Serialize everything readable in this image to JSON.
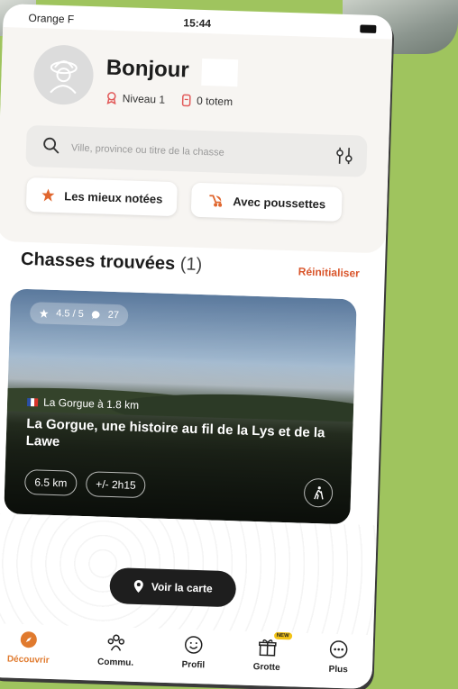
{
  "status_bar": {
    "carrier": "Orange F",
    "time": "15:44"
  },
  "header": {
    "greeting": "Bonjour",
    "level": "Niveau 1",
    "totems": "0 totem"
  },
  "search": {
    "placeholder": "Ville, province ou titre de la chasse"
  },
  "filters": [
    {
      "label": "Les mieux notées",
      "icon": "star-icon"
    },
    {
      "label": "Avec poussettes",
      "icon": "stroller-icon"
    }
  ],
  "results": {
    "title": "Chasses trouvées",
    "count": "(1)",
    "reset_label": "Réinitialiser"
  },
  "card": {
    "rating": "4.5 / 5",
    "comments": "27",
    "location": "La Gorgue à 1.8 km",
    "title": "La Gorgue, une histoire au fil de la Lys et de la Lawe",
    "distance": "6.5 km",
    "duration": "+/- 2h15"
  },
  "map_button": {
    "label": "Voir la carte"
  },
  "tabbar": [
    {
      "label": "Découvrir",
      "icon": "compass-icon",
      "active": true
    },
    {
      "label": "Commu.",
      "icon": "community-icon"
    },
    {
      "label": "Profil",
      "icon": "smiley-icon"
    },
    {
      "label": "Grotte",
      "icon": "gift-icon",
      "badge": "NEW"
    },
    {
      "label": "Plus",
      "icon": "more-icon"
    }
  ],
  "colors": {
    "accent": "#e07a2e",
    "reset": "#d9552b",
    "background": "#9fc45e"
  }
}
